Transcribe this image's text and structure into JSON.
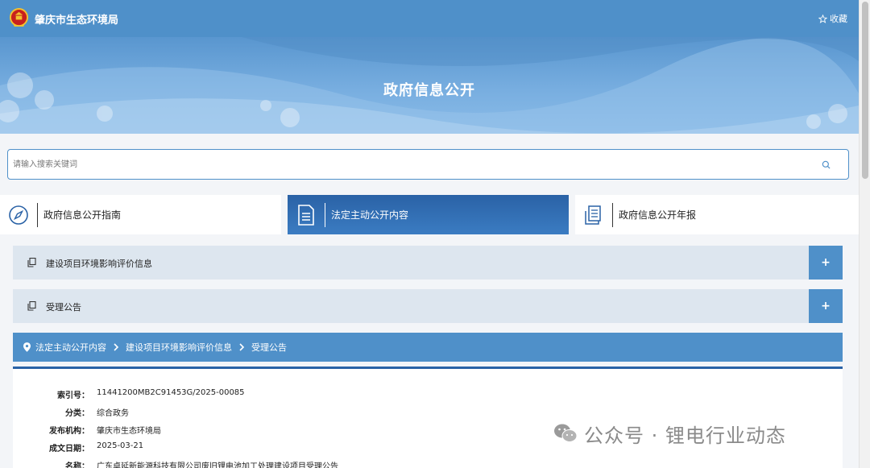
{
  "header": {
    "site_name": "肇庆市生态环境局",
    "favorite_label": "收藏",
    "emblem_icon": "national-emblem-icon",
    "favorite_icon": "star-icon"
  },
  "banner": {
    "title": "政府信息公开"
  },
  "search": {
    "placeholder": "请输入搜索关键词",
    "value": "",
    "icon": "search-icon"
  },
  "tabs": [
    {
      "label": "政府信息公开指南",
      "icon": "compass-icon",
      "active": false
    },
    {
      "label": "法定主动公开内容",
      "icon": "document-icon",
      "active": true
    },
    {
      "label": "政府信息公开年报",
      "icon": "report-icon",
      "active": false
    }
  ],
  "sections": [
    {
      "label": "建设项目环境影响评价信息",
      "toggle": "+"
    },
    {
      "label": "受理公告",
      "toggle": "+"
    }
  ],
  "breadcrumb": [
    "法定主动公开内容",
    "建设项目环境影响评价信息",
    "受理公告"
  ],
  "details": [
    {
      "key": "索引号：",
      "value": "11441200MB2C91453G/2025-00085"
    },
    {
      "key": "分类：",
      "value": "综合政务"
    },
    {
      "key": "发布机构：",
      "value": "肇庆市生态环境局"
    },
    {
      "key": "成文日期：",
      "value": "2025-03-21"
    },
    {
      "key": "名称：",
      "value": "广东卓延新能源科技有限公司废旧锂电池加工处理建设项目受理公告"
    }
  ],
  "watermark": {
    "text": "公众号 · 锂电行业动态",
    "icon": "wechat-icon"
  },
  "colors": {
    "primary": "#4f90c9",
    "active_tab": "#2a62a6",
    "section_bg": "#dde6ef"
  }
}
